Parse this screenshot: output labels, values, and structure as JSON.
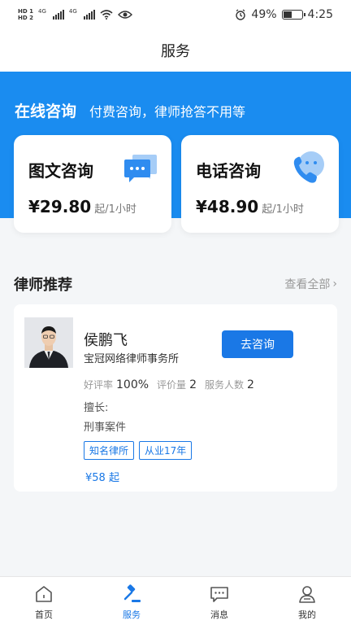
{
  "status_bar": {
    "hd1": "HD 1",
    "hd2": "HD 2",
    "net1": "4G",
    "net2": "4G",
    "battery_percent": "49%",
    "battery_level": 0.49,
    "time": "4:25"
  },
  "nav": {
    "title": "服务"
  },
  "hero": {
    "title": "在线咨询",
    "subtitle": "付费咨询，律师抢答不用等"
  },
  "consult_options": [
    {
      "title": "图文咨询",
      "price": "¥29.80",
      "unit": "起/1小时",
      "icon": "chat-bubble-icon"
    },
    {
      "title": "电话咨询",
      "price": "¥48.90",
      "unit": "起/1小时",
      "icon": "phone-icon"
    }
  ],
  "lawyers_section": {
    "title": "律师推荐",
    "view_all": "查看全部"
  },
  "lawyer": {
    "name": "侯鹏飞",
    "firm": "宝冠网络律师事务所",
    "consult_button": "去咨询",
    "rating_label": "好评率",
    "rating_value": "100%",
    "reviews_label": "评价量",
    "reviews_value": "2",
    "served_label": "服务人数",
    "served_value": "2",
    "specialty_label": "擅长:",
    "specialty_value": "刑事案件",
    "tags": [
      "知名律所",
      "从业17年"
    ],
    "from_price": "¥58 起"
  },
  "tabs": [
    {
      "label": "首页",
      "icon": "home-icon",
      "active": false
    },
    {
      "label": "服务",
      "icon": "gavel-icon",
      "active": true
    },
    {
      "label": "消息",
      "icon": "message-icon",
      "active": false
    },
    {
      "label": "我的",
      "icon": "profile-icon",
      "active": false
    }
  ],
  "colors": {
    "accent": "#1a8cf0",
    "button": "#1a78e6"
  }
}
